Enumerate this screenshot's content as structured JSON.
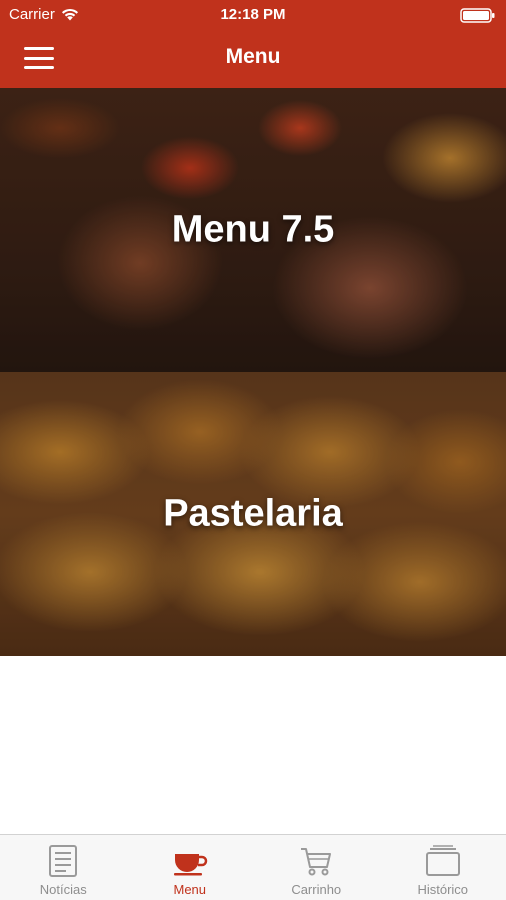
{
  "status_bar": {
    "carrier": "Carrier",
    "time": "12:18 PM"
  },
  "navbar": {
    "title": "Menu",
    "menu_icon": "hamburger-icon"
  },
  "categories": [
    {
      "title": "Menu 7.5",
      "image": "steak-photo"
    },
    {
      "title": "Pastelaria",
      "image": "croissant-photo"
    }
  ],
  "tabbar": {
    "tabs": [
      {
        "label": "Notícias",
        "icon": "newspaper-icon",
        "active": false
      },
      {
        "label": "Menu",
        "icon": "coffee-cup-icon",
        "active": true
      },
      {
        "label": "Carrinho",
        "icon": "cart-icon",
        "active": false
      },
      {
        "label": "Histórico",
        "icon": "history-icon",
        "active": false
      }
    ]
  },
  "colors": {
    "primary": "#c0321c",
    "tab_inactive": "#8e8e8e",
    "tab_bar_bg": "#f7f7f7"
  }
}
